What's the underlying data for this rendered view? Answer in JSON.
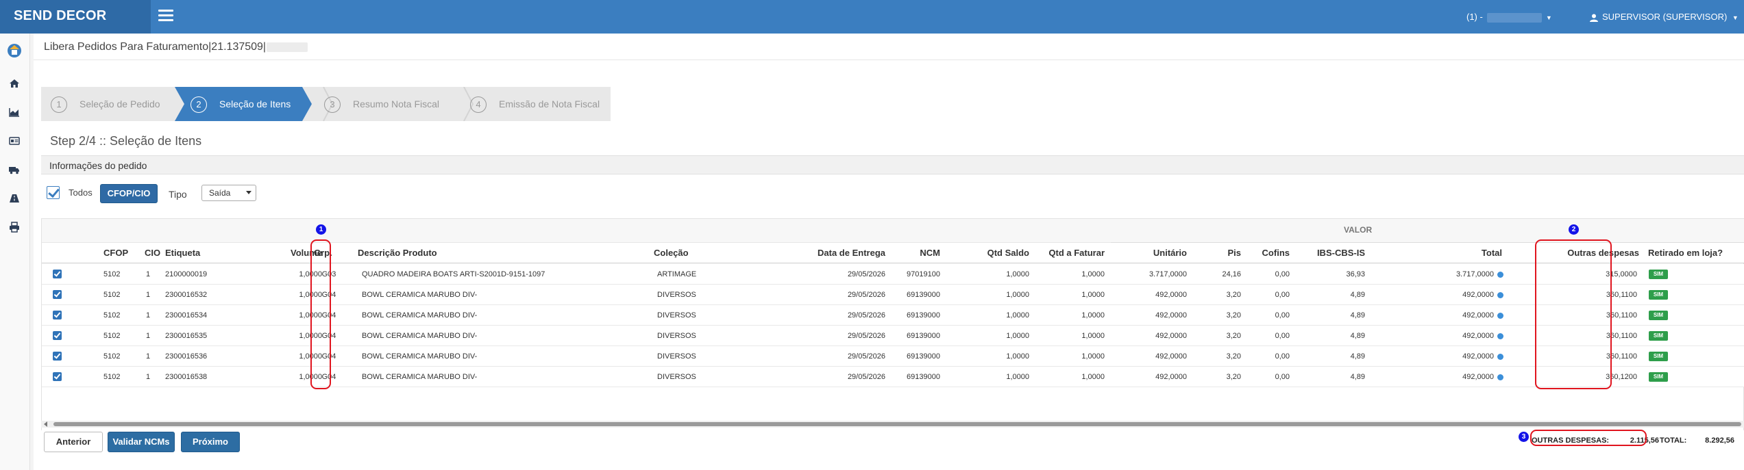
{
  "app": {
    "brand": "SEND DECOR",
    "session_label": "(1) -",
    "user_label": "SUPERVISOR (SUPERVISOR)"
  },
  "page": {
    "title": "Libera Pedidos Para Faturamento|21.137509|"
  },
  "stepper": {
    "steps": [
      {
        "num": "1",
        "label": "Seleção de Pedido"
      },
      {
        "num": "2",
        "label": "Seleção de Itens"
      },
      {
        "num": "3",
        "label": "Resumo Nota Fiscal"
      },
      {
        "num": "4",
        "label": "Emissão de Nota Fiscal"
      }
    ],
    "active": 2
  },
  "step_heading": "Step 2/4 :: Seleção de Itens",
  "info_section": "Informações do pedido",
  "controls": {
    "todos_label": "Todos",
    "cfop_button": "CFOP/CIO",
    "tipo_label": "Tipo",
    "tipo_value": "Saída"
  },
  "table": {
    "group_header": "VALOR",
    "columns": [
      "CFOP",
      "CIO",
      "Etiqueta",
      "Volume",
      "Grp.",
      "Descrição Produto",
      "Coleção",
      "Data de Entrega",
      "NCM",
      "Qtd Saldo",
      "Qtd a Faturar",
      "Unitário",
      "Pis",
      "Cofins",
      "IBS-CBS-IS",
      "Total",
      "Outras despesas",
      "Retirado em loja?"
    ],
    "rows": [
      {
        "cfop": "5102",
        "cio": "1",
        "etiqueta": "2100000019",
        "volume": "1,0000",
        "grp": "G03",
        "descricao": "QUADRO MADEIRA BOATS ARTI-S2001D-9151-1097",
        "colecao": "ARTIMAGE",
        "entrega": "29/05/2026",
        "ncm": "97019100",
        "saldo": "1,0000",
        "faturar": "1,0000",
        "unitario": "3.717,0000",
        "pis": "24,16",
        "cofins": "0,00",
        "ibs": "36,93",
        "total": "3.717,0000",
        "outras": "315,0000",
        "retirado": "SIM"
      },
      {
        "cfop": "5102",
        "cio": "1",
        "etiqueta": "2300016532",
        "volume": "1,0000",
        "grp": "G04",
        "descricao": "BOWL CERAMICA MARUBO DIV-",
        "colecao": "DIVERSOS",
        "entrega": "29/05/2026",
        "ncm": "69139000",
        "saldo": "1,0000",
        "faturar": "1,0000",
        "unitario": "492,0000",
        "pis": "3,20",
        "cofins": "0,00",
        "ibs": "4,89",
        "total": "492,0000",
        "outras": "360,1100",
        "retirado": "SIM"
      },
      {
        "cfop": "5102",
        "cio": "1",
        "etiqueta": "2300016534",
        "volume": "1,0000",
        "grp": "G04",
        "descricao": "BOWL CERAMICA MARUBO DIV-",
        "colecao": "DIVERSOS",
        "entrega": "29/05/2026",
        "ncm": "69139000",
        "saldo": "1,0000",
        "faturar": "1,0000",
        "unitario": "492,0000",
        "pis": "3,20",
        "cofins": "0,00",
        "ibs": "4,89",
        "total": "492,0000",
        "outras": "360,1100",
        "retirado": "SIM"
      },
      {
        "cfop": "5102",
        "cio": "1",
        "etiqueta": "2300016535",
        "volume": "1,0000",
        "grp": "G04",
        "descricao": "BOWL CERAMICA MARUBO DIV-",
        "colecao": "DIVERSOS",
        "entrega": "29/05/2026",
        "ncm": "69139000",
        "saldo": "1,0000",
        "faturar": "1,0000",
        "unitario": "492,0000",
        "pis": "3,20",
        "cofins": "0,00",
        "ibs": "4,89",
        "total": "492,0000",
        "outras": "360,1100",
        "retirado": "SIM"
      },
      {
        "cfop": "5102",
        "cio": "1",
        "etiqueta": "2300016536",
        "volume": "1,0000",
        "grp": "G04",
        "descricao": "BOWL CERAMICA MARUBO DIV-",
        "colecao": "DIVERSOS",
        "entrega": "29/05/2026",
        "ncm": "69139000",
        "saldo": "1,0000",
        "faturar": "1,0000",
        "unitario": "492,0000",
        "pis": "3,20",
        "cofins": "0,00",
        "ibs": "4,89",
        "total": "492,0000",
        "outras": "360,1100",
        "retirado": "SIM"
      },
      {
        "cfop": "5102",
        "cio": "1",
        "etiqueta": "2300016538",
        "volume": "1,0000",
        "grp": "G04",
        "descricao": "BOWL CERAMICA MARUBO DIV-",
        "colecao": "DIVERSOS",
        "entrega": "29/05/2026",
        "ncm": "69139000",
        "saldo": "1,0000",
        "faturar": "1,0000",
        "unitario": "492,0000",
        "pis": "3,20",
        "cofins": "0,00",
        "ibs": "4,89",
        "total": "492,0000",
        "outras": "360,1200",
        "retirado": "SIM"
      }
    ]
  },
  "totals": {
    "outras_label": "OUTRAS DESPESAS:",
    "outras_value": "2.115,56",
    "total_label": "TOTAL:",
    "total_value": "8.292,56"
  },
  "annotations": {
    "m1": "1",
    "m2": "2",
    "m3": "3"
  },
  "buttons": {
    "anterior": "Anterior",
    "validar": "Validar NCMs",
    "proximo": "Próximo"
  },
  "colors": {
    "primary": "#3b7ec0",
    "annotation_red": "#e0141e",
    "marker_blue": "#1414e8",
    "badge_green": "#2e9e4b"
  }
}
